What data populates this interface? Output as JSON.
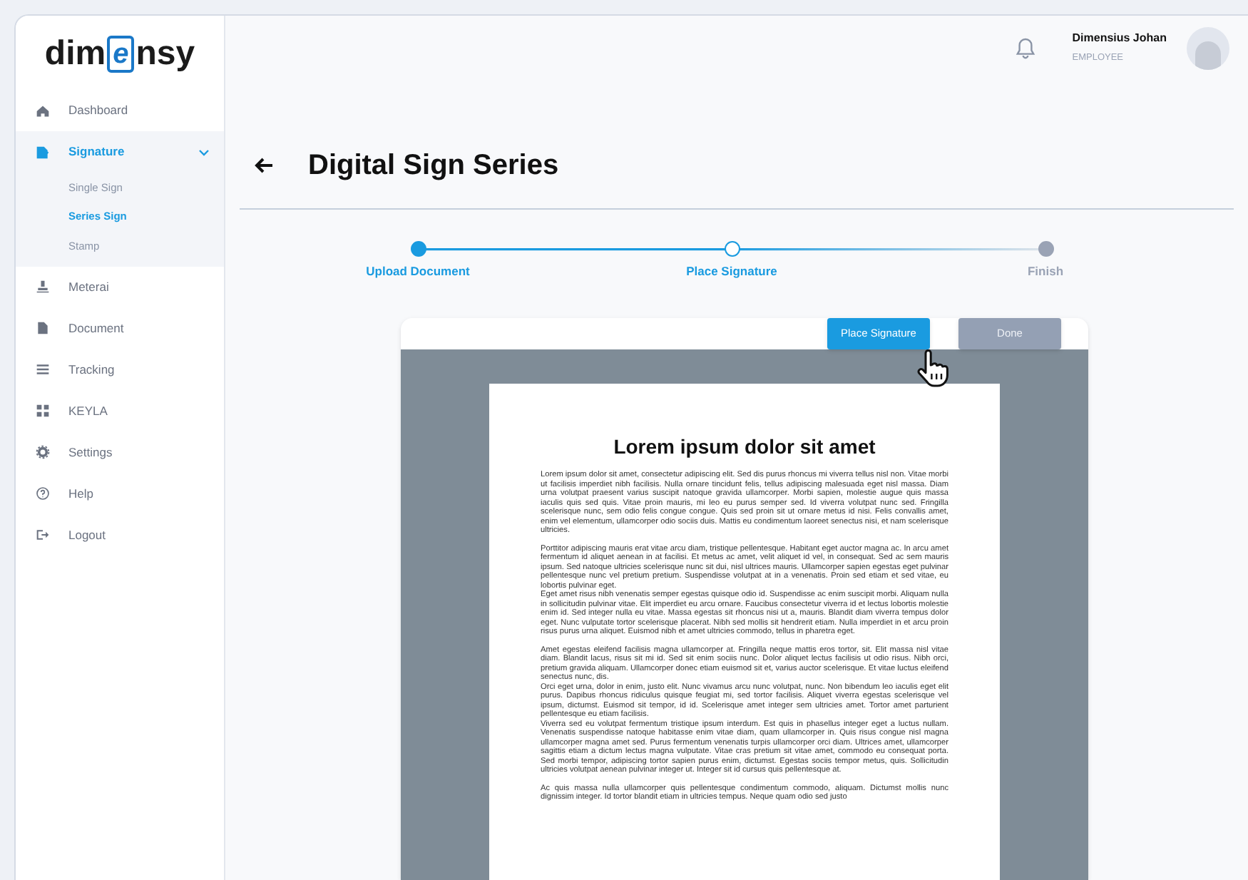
{
  "logo": {
    "parts": [
      "dim",
      "e",
      "nsy"
    ]
  },
  "sidebar": {
    "items": [
      {
        "label": "Dashboard",
        "selected": false
      },
      {
        "label": "Signature",
        "selected": true,
        "expanded": true,
        "children": [
          {
            "label": "Single Sign",
            "selected": false
          },
          {
            "label": "Series Sign",
            "selected": true
          },
          {
            "label": "Stamp",
            "selected": false
          }
        ]
      },
      {
        "label": "Meterai",
        "selected": false
      },
      {
        "label": "Document",
        "selected": false
      },
      {
        "label": "Tracking",
        "selected": false
      },
      {
        "label": "KEYLA",
        "selected": false
      },
      {
        "label": "Settings",
        "selected": false
      },
      {
        "label": "Help",
        "selected": false
      },
      {
        "label": "Logout",
        "selected": false
      }
    ]
  },
  "user": {
    "name": "Dimensius Johan",
    "role": "EMPLOYEE"
  },
  "page_title": "Digital Sign Series",
  "steps": [
    {
      "label": "Upload Document",
      "done": true,
      "selected": false
    },
    {
      "label": "Place Signature",
      "done": false,
      "selected": true
    },
    {
      "label": "Finish",
      "done": false,
      "selected": false
    }
  ],
  "toolbar": {
    "buttons": [
      {
        "label": "Place Signature",
        "kind": "primary"
      },
      {
        "label": "Done",
        "kind": "muted"
      }
    ]
  },
  "document": {
    "title": "Lorem ipsum dolor sit amet",
    "sections": [
      [
        "Lorem ipsum dolor sit amet, consectetur adipiscing elit. Sed dis purus rhoncus mi viverra tellus nisl non. Vitae morbi ut facilisis imperdiet nibh facilisis. Nulla ornare tincidunt felis, tellus adipiscing malesuada eget nisl massa. Diam urna volutpat praesent varius suscipit natoque gravida ullamcorper. Morbi sapien, molestie augue quis massa iaculis quis sed quis. Vitae proin mauris, mi leo eu purus semper sed. Id viverra volutpat nunc sed. Fringilla scelerisque nunc, sem odio felis congue congue. Quis sed proin sit ut ornare metus id nisi. Felis convallis amet, enim vel elementum, ullamcorper odio sociis duis. Mattis eu condimentum laoreet senectus nisi, et nam scelerisque ultricies."
      ],
      [
        "Porttitor adipiscing mauris erat vitae arcu diam, tristique pellentesque. Habitant eget auctor magna ac. In arcu amet fermentum id aliquet aenean in at facilisi. Et metus ac amet, velit aliquet id vel, in consequat. Sed ac sem mauris ipsum. Sed natoque ultricies scelerisque nunc sit dui, nisl ultrices mauris. Ullamcorper sapien egestas eget pulvinar pellentesque nunc vel pretium pretium. Suspendisse volutpat at in a venenatis. Proin sed etiam et sed vitae, eu lobortis pulvinar eget.",
        "Eget amet risus nibh venenatis semper egestas quisque odio id. Suspendisse ac enim suscipit morbi. Aliquam nulla in sollicitudin pulvinar vitae. Elit imperdiet eu arcu ornare. Faucibus consectetur viverra id et lectus lobortis molestie enim id. Sed integer nulla eu vitae. Massa egestas sit rhoncus nisi ut a, mauris. Blandit diam viverra tempus dolor eget. Nunc vulputate tortor scelerisque placerat. Nibh sed mollis sit hendrerit etiam. Nulla imperdiet in et arcu proin risus purus urna aliquet. Euismod nibh et amet ultricies commodo, tellus in pharetra eget."
      ],
      [
        "Amet egestas eleifend facilisis magna ullamcorper at. Fringilla neque mattis eros tortor, sit. Elit massa nisl vitae diam. Blandit lacus, risus sit mi id. Sed sit enim sociis nunc. Dolor aliquet lectus facilisis ut odio risus. Nibh orci, pretium gravida aliquam. Ullamcorper donec etiam euismod sit et, varius auctor scelerisque. Et vitae luctus eleifend senectus nunc, dis.",
        "Orci eget urna, dolor in enim, justo elit. Nunc vivamus arcu nunc volutpat, nunc. Non bibendum leo iaculis eget elit purus. Dapibus rhoncus ridiculus quisque feugiat mi, sed tortor facilisis. Aliquet viverra egestas scelerisque vel ipsum, dictumst. Euismod sit tempor, id id. Scelerisque amet integer sem ultricies amet. Tortor amet parturient pellentesque eu etiam facilisis.",
        "Viverra sed eu volutpat fermentum tristique ipsum interdum. Est quis in phasellus integer eget a luctus nullam. Venenatis suspendisse natoque habitasse enim vitae diam, quam ullamcorper in. Quis risus congue nisl magna ullamcorper magna amet sed. Purus fermentum venenatis turpis ullamcorper orci diam. Ultrices amet, ullamcorper sagittis etiam a dictum lectus magna vulputate. Vitae cras pretium sit vitae amet, commodo eu consequat porta. Sed morbi tempor, adipiscing tortor sapien purus enim, dictumst. Egestas sociis tempor metus, quis. Sollicitudin ultricies volutpat aenean pulvinar integer ut. Integer sit id cursus quis pellentesque at."
      ],
      [
        "Ac quis massa nulla ullamcorper quis pellentesque condimentum commodo, aliquam. Dictumst mollis nunc dignissim integer. Id tortor blandit etiam in ultricies tempus. Neque quam odio sed justo"
      ]
    ]
  }
}
